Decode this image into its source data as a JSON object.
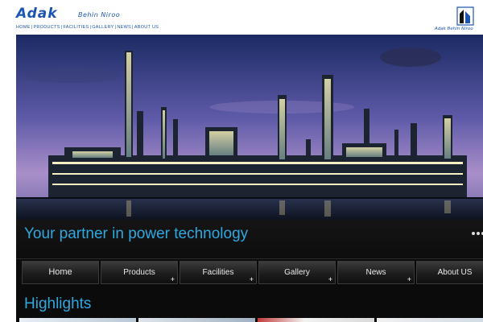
{
  "header": {
    "logo_text": "Adak",
    "logo_sub": "Behin Niroo",
    "brand_caption": "Adak Behin Niroo"
  },
  "topnav": {
    "items": [
      "HOME",
      "PRODUCTS",
      "FACILITIES",
      "GALLERY",
      "NEWS",
      "ABOUT US"
    ]
  },
  "hero": {
    "image_subject": "refinery-at-dusk"
  },
  "tagline": "Your partner in power technology",
  "menu": {
    "items": [
      {
        "label": "Home",
        "has_submenu": false
      },
      {
        "label": "Products",
        "has_submenu": true
      },
      {
        "label": "Facilities",
        "has_submenu": true
      },
      {
        "label": "Gallery",
        "has_submenu": true
      },
      {
        "label": "News",
        "has_submenu": true
      },
      {
        "label": "About US",
        "has_submenu": false
      }
    ],
    "submenu_glyph": "+"
  },
  "highlights": {
    "title": "Highlights"
  },
  "colors": {
    "brand_blue": "#1a55b0",
    "accent_cyan": "#2fa8e0",
    "panel_bg": "#0b0b0b"
  }
}
